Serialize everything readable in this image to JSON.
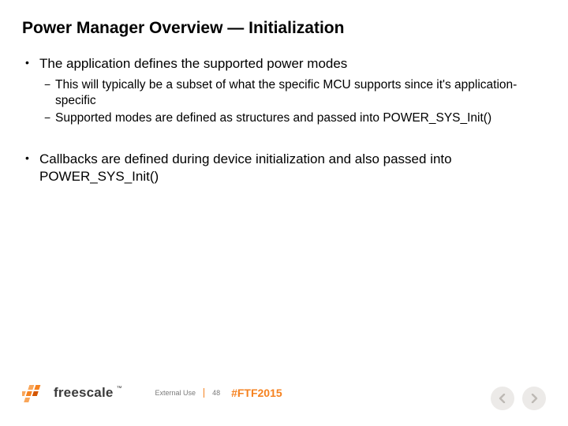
{
  "title": "Power Manager Overview — Initialization",
  "groups": [
    {
      "main": "The application defines the supported power modes",
      "subs": [
        "This will typically be a subset of what the specific MCU supports since it's application-specific",
        "Supported modes are defined as structures and passed into POWER_SYS_Init()"
      ]
    },
    {
      "main": "Callbacks are defined during device initialization and also passed into POWER_SYS_Init()",
      "subs": []
    }
  ],
  "footer": {
    "brand": "freescale",
    "tm": "™",
    "external_use": "External Use",
    "page": "48",
    "hashtag": "#FTF2015"
  }
}
